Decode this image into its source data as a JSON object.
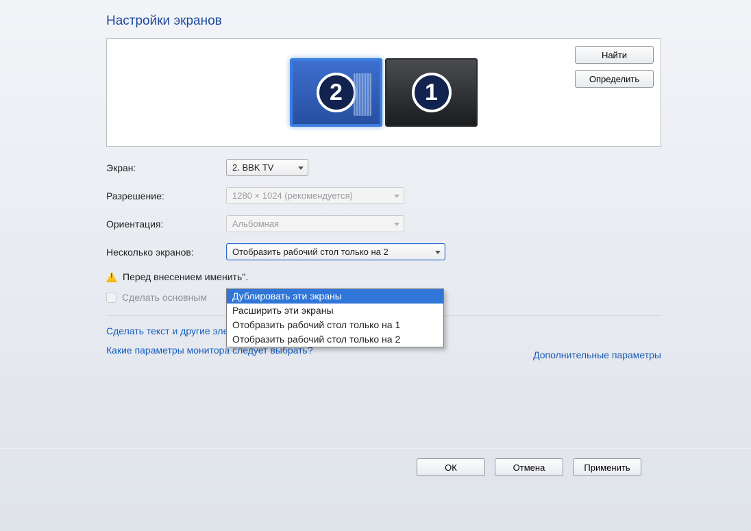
{
  "title": "Настройки экранов",
  "arrangement": {
    "find_label": "Найти",
    "identify_label": "Определить",
    "monitors": [
      {
        "number": "2",
        "selected": true
      },
      {
        "number": "1",
        "selected": false
      }
    ]
  },
  "form": {
    "display_label": "Экран:",
    "display_value": "2. BBK TV",
    "resolution_label": "Разрешение:",
    "resolution_value": "1280 × 1024 (рекомендуется)",
    "orientation_label": "Ориентация:",
    "orientation_value": "Альбомная",
    "multi_label": "Несколько экранов:",
    "multi_value": "Отобразить рабочий стол только на 2",
    "multi_options": [
      "Дублировать эти экраны",
      "Расширить эти экраны",
      "Отобразить рабочий стол только на 1",
      "Отобразить рабочий стол только на 2"
    ],
    "multi_selected_index": 0
  },
  "warning_text": "Перед внесением                                                                              именить\".",
  "primary_checkbox": "Сделать основным",
  "advanced_link": "Дополнительные параметры",
  "link_text_size": "Сделать текст и другие элементы больше или меньше",
  "link_which_params": "Какие параметры монитора следует выбрать?",
  "buttons": {
    "ok": "ОК",
    "cancel": "Отмена",
    "apply": "Применить"
  }
}
